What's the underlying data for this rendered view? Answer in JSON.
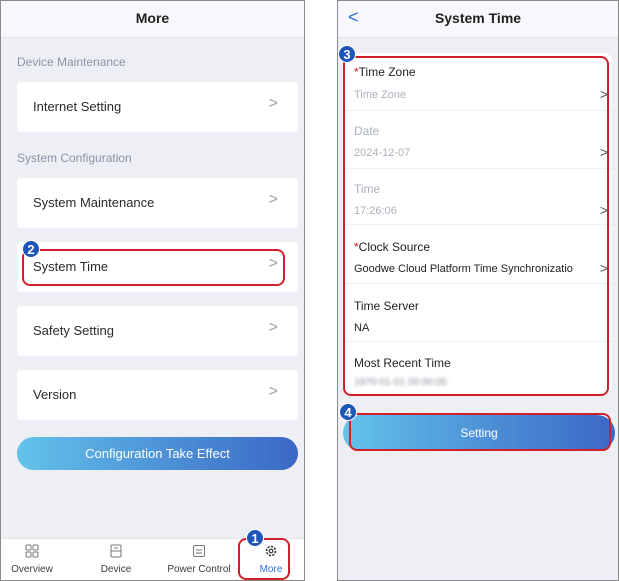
{
  "left": {
    "title": "More",
    "sections": {
      "device_maintenance": "Device Maintenance",
      "system_configuration": "System Configuration"
    },
    "items": {
      "internet_setting": "Internet Setting",
      "system_maintenance": "System Maintenance",
      "system_time": "System Time",
      "safety_setting": "Safety Setting",
      "version": "Version"
    },
    "chevron": ">",
    "config_button": "Configuration Take Effect",
    "tabs": {
      "overview": "Overview",
      "device": "Device",
      "power_control": "Power Control",
      "more": "More"
    }
  },
  "right": {
    "back": "<",
    "title": "System Time",
    "time_zone": {
      "star": "*",
      "label": "Time Zone",
      "placeholder": "Time Zone"
    },
    "date": {
      "label": "Date",
      "value": "2024-12-07"
    },
    "time": {
      "label": "Time",
      "value": "17:26:06"
    },
    "clock_source": {
      "star": "*",
      "label": "Clock Source",
      "value": "Goodwe Cloud Platform Time Synchronizatio"
    },
    "time_server": {
      "label": "Time Server",
      "value": "NA"
    },
    "most_recent_time": {
      "label": "Most Recent Time",
      "value": "1970-01-01 00:00:00"
    },
    "setting_button": "Setting"
  },
  "steps": {
    "one": "1",
    "two": "2",
    "three": "3",
    "four": "4"
  },
  "colors": {
    "accent_blue": "#2f6fd6",
    "callout_red": "#d0202b",
    "badge_blue": "#1e56b8"
  },
  "icons": {
    "overview": "grid-icon",
    "device": "device-icon",
    "power_control": "power-control-icon",
    "more": "gear-icon",
    "back": "chevron-left-icon",
    "row": "chevron-right-icon"
  }
}
